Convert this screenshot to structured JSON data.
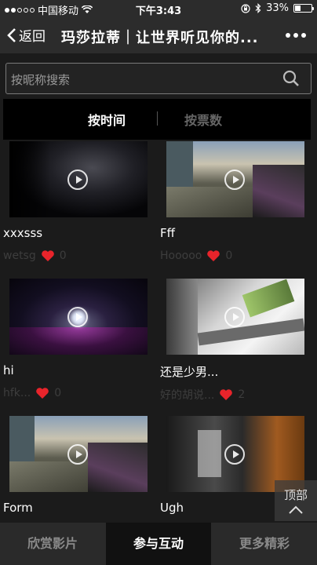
{
  "status": {
    "carrier": "中国移动",
    "time": "下午3:43",
    "battery": "33%",
    "battery_level": 0.33,
    "signal_dots": 5,
    "signal_filled": 2
  },
  "nav": {
    "back_label": "返回",
    "title": "玛莎拉蒂｜让世界听见你的..."
  },
  "search": {
    "placeholder": "按昵称搜索"
  },
  "sort": {
    "by_time": "按时间",
    "by_votes": "按票数"
  },
  "videos": [
    {
      "title": "xxxsss",
      "user": "wetsg",
      "votes": "0"
    },
    {
      "title": "Fff",
      "user": "Hooooo",
      "votes": "0"
    },
    {
      "title": "hi",
      "user": "hfk...",
      "votes": "0"
    },
    {
      "title": "还是少男...",
      "user": "好的胡说...",
      "votes": "2"
    },
    {
      "title": "Form",
      "user": "",
      "votes": ""
    },
    {
      "title": "Ugh",
      "user": "",
      "votes": ""
    }
  ],
  "back_to_top": "顶部",
  "tabs": [
    {
      "label": "欣赏影片"
    },
    {
      "label": "参与互动"
    },
    {
      "label": "更多精彩"
    }
  ],
  "colors": {
    "heart": "#e8242b",
    "active_tab": "#111111"
  }
}
